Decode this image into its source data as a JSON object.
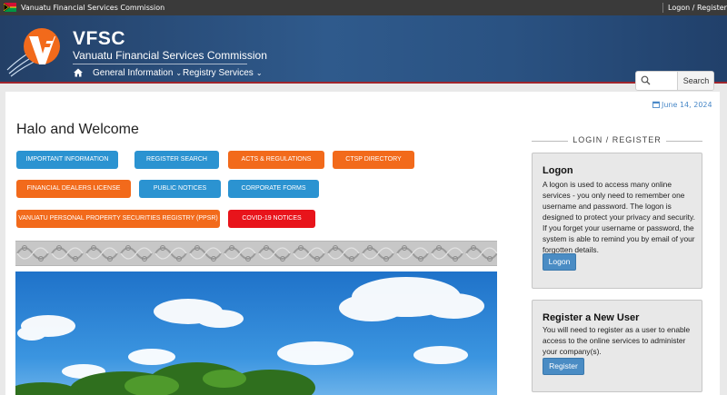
{
  "topbar": {
    "site_name": "Vanuatu Financial Services Commission",
    "login_register": "Logon / Register"
  },
  "header": {
    "brand": "VFSC",
    "tagline": "Vanuatu Financial Services Commission",
    "nav": [
      {
        "label": "General Information"
      },
      {
        "label": "Registry Services"
      }
    ],
    "search": {
      "placeholder": "",
      "button": "Search"
    }
  },
  "main": {
    "date": "June 14, 2024",
    "heading": "Halo and Welcome",
    "buttons": [
      {
        "label": "IMPORTANT INFORMATION",
        "color": "#2b93d1"
      },
      {
        "label": "REGISTER SEARCH",
        "color": "#2b93d1"
      },
      {
        "label": "ACTS & REGULATIONS",
        "color": "#f26a1b"
      },
      {
        "label": "CTSP DIRECTORY",
        "color": "#f26a1b"
      },
      {
        "label": "FINANCIAL DEALERS LICENSE",
        "color": "#f26a1b"
      },
      {
        "label": "PUBLIC NOTICES",
        "color": "#2b93d1"
      },
      {
        "label": "CORPORATE FORMS",
        "color": "#2b93d1"
      },
      {
        "label": "VANUATU PERSONAL PROPERTY SECURITIES REGISTRY (PPSR)",
        "color": "#f26a1b"
      },
      {
        "label": "COVID-19 NOTICES",
        "color": "#e8141b"
      }
    ]
  },
  "sidebar": {
    "title": "LOGIN / REGISTER",
    "logon": {
      "heading": "Logon",
      "text": "A logon is used to access many online services - you only need to remember one username and password. The logon is designed to protect your privacy and security. If you forget your username or password, the system is able to remind you by email of your forgotten details.",
      "button": "Logon"
    },
    "register": {
      "heading": "Register a New User",
      "text": "You will need to register as a user to enable access to the online services to administer your company(s).",
      "button": "Register"
    }
  },
  "colors": {
    "header_start": "#233f66",
    "header_end": "#2f5a8c",
    "accent_orange": "#f26a1b",
    "accent_blue": "#2b93d1",
    "accent_red": "#e8141b",
    "topbar": "#3a3a3a"
  },
  "icons": [
    "vanuatu-flag-icon",
    "vfsc-logo",
    "home-icon",
    "chevron-down-icon",
    "search-icon",
    "calendar-icon"
  ]
}
